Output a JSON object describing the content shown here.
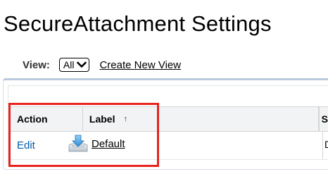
{
  "page": {
    "title": "SecureAttachment Settings"
  },
  "view_bar": {
    "label": "View:",
    "select_value": "All",
    "create_link": "Create New View"
  },
  "table": {
    "columns": [
      {
        "label": "Action"
      },
      {
        "label": "Label",
        "sort_icon": "↑",
        "sorted": "ascending"
      },
      {
        "label": "S"
      }
    ],
    "rows": [
      {
        "action": "Edit",
        "icon": "download-icon",
        "label": "Default",
        "next_cell": "D"
      }
    ]
  },
  "colors": {
    "link_blue": "#015ba7",
    "highlight_red": "#e8231f",
    "panel_border": "#b9c9de",
    "header_bg": "#f2f3f4"
  }
}
